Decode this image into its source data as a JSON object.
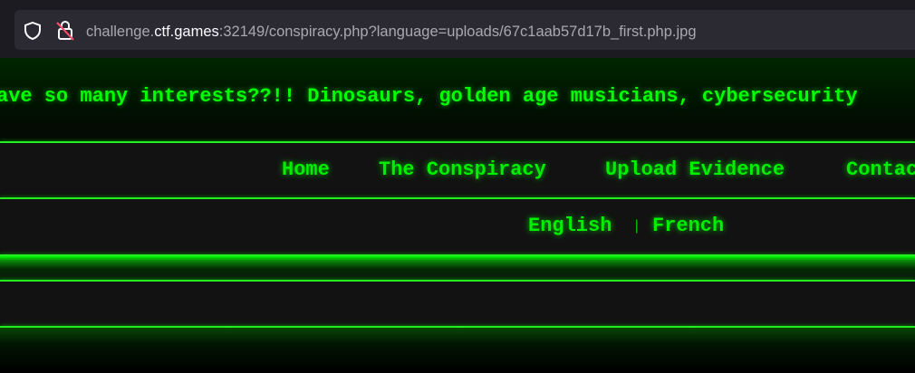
{
  "browser": {
    "url_prefix": "challenge.",
    "url_host": "ctf.games",
    "url_rest": ":32149/conspiracy.php?language=uploads/67c1aab57d17b_first.php.jpg",
    "icons": [
      "shield-icon",
      "lock-icon"
    ]
  },
  "banner": {
    "text": "ave so many interests??!! Dinosaurs, golden age musicians, cybersecurity"
  },
  "nav": {
    "items": [
      "Home",
      "The Conspiracy",
      "Upload Evidence",
      "Contact"
    ]
  },
  "language": {
    "options": [
      "English",
      "French"
    ],
    "separator": "|"
  },
  "colors": {
    "accent": "#00ff00",
    "background": "#000000",
    "panel": "#121212"
  }
}
